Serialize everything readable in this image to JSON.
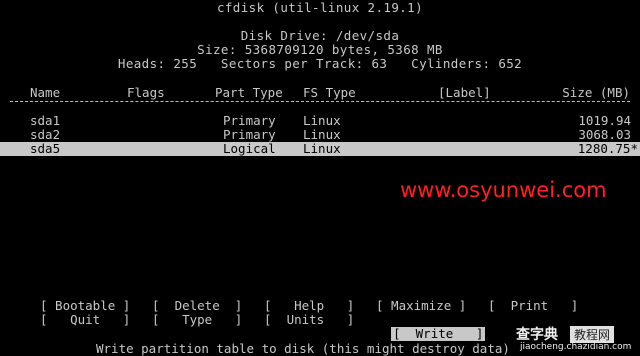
{
  "header": {
    "title": "cfdisk (util-linux 2.19.1)",
    "disk_drive": "Disk Drive: /dev/sda",
    "size_line": "Size: 5368709120 bytes, 5368 MB",
    "geometry_line": "Heads: 255   Sectors per Track: 63   Cylinders: 652"
  },
  "table": {
    "columns": {
      "name": "Name",
      "flags": "Flags",
      "part_type": "Part Type",
      "fs_type": "FS Type",
      "label": "[Label]",
      "size": "Size (MB)"
    },
    "rows": [
      {
        "name": "sda1",
        "flags": "",
        "part_type": "Primary",
        "fs_type": "Linux",
        "label": "",
        "size": "1019.94"
      },
      {
        "name": "sda2",
        "flags": "",
        "part_type": "Primary",
        "fs_type": "Linux",
        "label": "",
        "size": "3068.03"
      },
      {
        "name": "sda5",
        "flags": "",
        "part_type": "Logical",
        "fs_type": "Linux",
        "label": "",
        "size": "1280.75*"
      }
    ],
    "selected_row": 2
  },
  "menu": {
    "bootable": "[ Bootable ]",
    "delete": "[  Delete  ]",
    "help": "[   Help   ]",
    "maximize": "[ Maximize ]",
    "print": "[  Print   ]",
    "quit": "[   Quit   ]",
    "type": "[   Type   ]",
    "units": "[  Units   ]",
    "write": "[  Write   ]",
    "selected": "write"
  },
  "status": {
    "message": "Write partition table to disk (this might destroy data)"
  },
  "watermark": {
    "text": "www.osyunwei.com"
  },
  "logo": {
    "line1": "查字典",
    "badge": "教程网",
    "line2": "jiaocheng.chazidian.com"
  }
}
